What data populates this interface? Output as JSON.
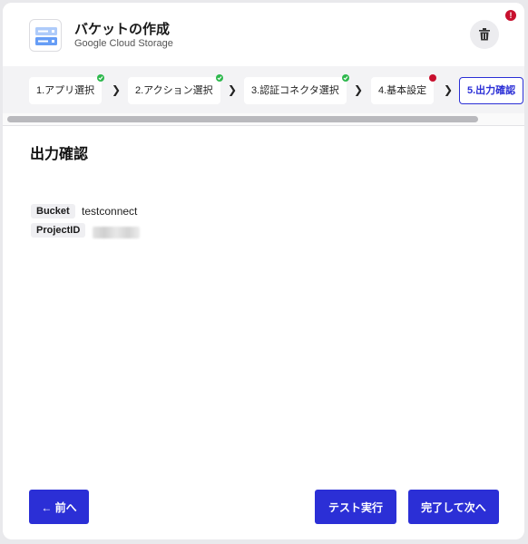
{
  "header": {
    "title": "バケットの作成",
    "subtitle": "Google Cloud Storage",
    "app_icon": "gcs-bucket-icon",
    "delete_icon": "trash-icon",
    "alert_badge": "!"
  },
  "steps": [
    {
      "label": "1.アプリ選択",
      "status": "complete"
    },
    {
      "label": "2.アクション選択",
      "status": "complete"
    },
    {
      "label": "3.認証コネクタ選択",
      "status": "complete"
    },
    {
      "label": "4.基本設定",
      "status": "error"
    },
    {
      "label": "5.出力確認",
      "status": "active"
    }
  ],
  "main": {
    "section_title": "出力確認",
    "fields": [
      {
        "key": "Bucket",
        "value": "testconnect"
      },
      {
        "key": "ProjectID",
        "value": ""
      }
    ]
  },
  "footer": {
    "back_label": "← 前へ",
    "test_label": "テスト実行",
    "next_label": "完了して次へ"
  },
  "colors": {
    "accent": "#2b2fd6",
    "success": "#2eb84d",
    "error": "#c8102e"
  }
}
